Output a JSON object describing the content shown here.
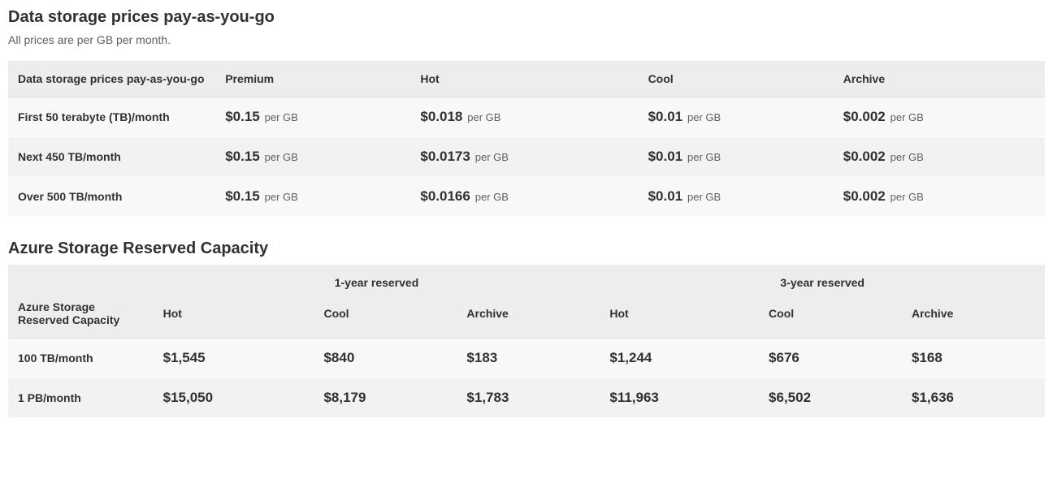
{
  "section1": {
    "title": "Data storage prices pay-as-you-go",
    "subtitle": "All prices are per GB per month.",
    "headers": [
      "Data storage prices pay-as-you-go",
      "Premium",
      "Hot",
      "Cool",
      "Archive"
    ],
    "unit": "per GB",
    "rows": [
      {
        "label": "First 50 terabyte (TB)/month",
        "premium": "$0.15",
        "hot": "$0.018",
        "cool": "$0.01",
        "archive": "$0.002"
      },
      {
        "label": "Next 450 TB/month",
        "premium": "$0.15",
        "hot": "$0.0173",
        "cool": "$0.01",
        "archive": "$0.002"
      },
      {
        "label": "Over 500 TB/month",
        "premium": "$0.15",
        "hot": "$0.0166",
        "cool": "$0.01",
        "archive": "$0.002"
      }
    ]
  },
  "section2": {
    "title": "Azure Storage Reserved Capacity",
    "group_headers": [
      "1-year reserved",
      "3-year reserved"
    ],
    "sub_headers": [
      "Azure Storage Reserved Capacity",
      "Hot",
      "Cool",
      "Archive",
      "Hot",
      "Cool",
      "Archive"
    ],
    "rows": [
      {
        "label": "100 TB/month",
        "y1_hot": "$1,545",
        "y1_cool": "$840",
        "y1_archive": "$183",
        "y3_hot": "$1,244",
        "y3_cool": "$676",
        "y3_archive": "$168"
      },
      {
        "label": "1 PB/month",
        "y1_hot": "$15,050",
        "y1_cool": "$8,179",
        "y1_archive": "$1,783",
        "y3_hot": "$11,963",
        "y3_cool": "$6,502",
        "y3_archive": "$1,636"
      }
    ]
  }
}
